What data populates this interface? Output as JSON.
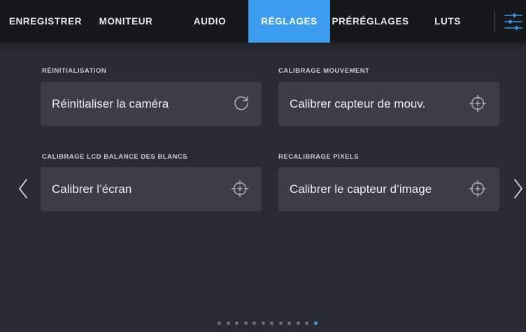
{
  "tabs": [
    {
      "label": "ENREGISTRER",
      "active": false
    },
    {
      "label": "MONITEUR",
      "active": false
    },
    {
      "label": "AUDIO",
      "active": false
    },
    {
      "label": "RÉGLAGES",
      "active": true
    },
    {
      "label": "PRÉRÉGLAGES",
      "active": false
    },
    {
      "label": "LUTS",
      "active": false
    }
  ],
  "menu_icon": "sliders-icon",
  "sections": {
    "reset": {
      "title": "RÉINITIALISATION",
      "button_label": "Réinitialiser la caméra",
      "icon": "refresh-icon"
    },
    "motion": {
      "title": "CALIBRAGE MOUVEMENT",
      "button_label": "Calibrer capteur de mouv.",
      "icon": "crosshair-icon"
    },
    "lcd": {
      "title": "CALIBRAGE LCD BALANCE DES BLANCS",
      "button_label": "Calibrer l’écran",
      "icon": "crosshair-icon"
    },
    "pixels": {
      "title": "RECALIBRAGE PIXELS",
      "button_label": "Calibrer le capteur d’image",
      "icon": "crosshair-icon"
    }
  },
  "pager": {
    "total_pages": 12,
    "current_page": 12
  },
  "colors": {
    "accent": "#3b9cf0",
    "background": "#2a2c33",
    "tab_bar": "#17181c",
    "card": "#3b3e47"
  }
}
